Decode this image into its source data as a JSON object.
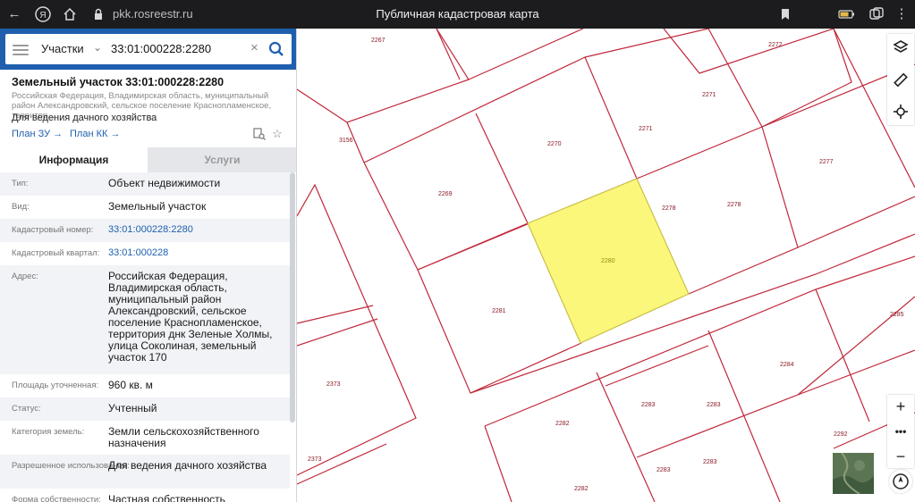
{
  "browser": {
    "url": "pkk.rosreestr.ru",
    "title": "Публичная кадастровая карта",
    "icons": {
      "back": "arrow-left-icon",
      "yandex": "yandex-logo-icon",
      "lock": "lock-icon",
      "bookmark": "bookmark-icon",
      "battery": "battery-icon",
      "tabs": "tabs-icon",
      "menu": "dots-menu-icon"
    }
  },
  "search": {
    "category": "Участки",
    "value": "33:01:000228:2280",
    "icons": {
      "menu": "hamburger-icon",
      "clear": "close-icon",
      "search": "search-icon",
      "chevron": "chevron-down-icon",
      "collapse": "chevron-left-icon"
    }
  },
  "object": {
    "title": "Земельный участок 33:01:000228:2280",
    "address_short": "Российская Федерация, Владимирская область, муниципальный район Александровский, сельское поселение Краснопламенское, территор...",
    "use": "Для ведения дачного хозяйства",
    "plan_zu": "План ЗУ",
    "plan_kk": "План КК",
    "arrow": "→",
    "icons": {
      "doc_search": "document-search-icon",
      "star": "star-icon"
    }
  },
  "tabs": {
    "info": "Информация",
    "services": "Услуги"
  },
  "info": [
    {
      "label": "Тип:",
      "value": "Объект недвижимости"
    },
    {
      "label": "Вид:",
      "value": "Земельный участок"
    },
    {
      "label": "Кадастровый номер:",
      "value": "33:01:000228:2280",
      "link": true
    },
    {
      "label": "Кадастровый квартал:",
      "value": "33:01:000228",
      "link": true
    },
    {
      "label": "Адрес:",
      "value": "Российская Федерация, Владимирская область, муниципальный район Александровский, сельское поселение Краснопламенское, территория днк Зеленые Холмы, улица Соколиная, земельный участок 170"
    },
    {
      "label": "Площадь уточненная:",
      "value": "960 кв. м"
    },
    {
      "label": "Статус:",
      "value": "Учтенный"
    },
    {
      "label": "Категория земель:",
      "value": "Земли сельскохозяйственного назначения"
    },
    {
      "label": "Разрешенное использование:",
      "value": "Для ведения дачного хозяйства"
    },
    {
      "label": "Форма собственности:",
      "value": "Частная собственность"
    }
  ],
  "map": {
    "parcel_labels": [
      "2267",
      "2272",
      "3156",
      "2271",
      "2271",
      "2270",
      "2277",
      "2269",
      "2278",
      "2278",
      "2280",
      "2281",
      "2285",
      "2284",
      "2373",
      "2283",
      "2283",
      "2282",
      "2292",
      "2373",
      "2283",
      "2283",
      "2282"
    ],
    "highlight_color": "#fbf77a",
    "boundary_color": "#c0283a",
    "controls": [
      "layers-icon",
      "ruler-icon",
      "locate-icon",
      "zoom-in-icon",
      "more-icon",
      "zoom-out-icon",
      "compass-icon"
    ],
    "minimap": "satellite-minimap"
  }
}
